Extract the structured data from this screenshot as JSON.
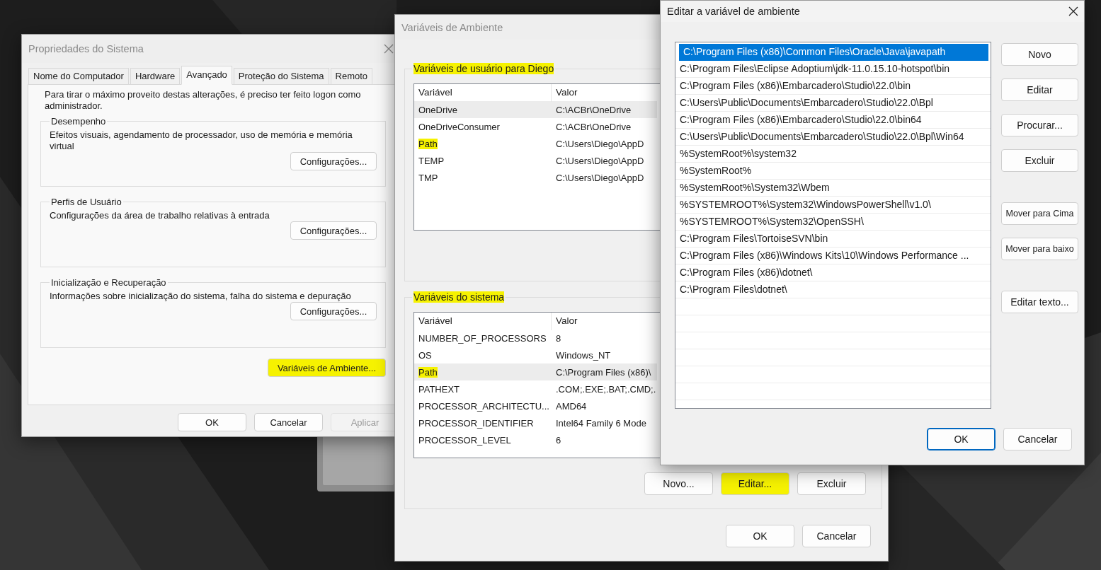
{
  "system_properties": {
    "title": "Propriedades do Sistema",
    "active": false,
    "tabs": [
      {
        "label": "Nome do Computador",
        "selected": false
      },
      {
        "label": "Hardware",
        "selected": false
      },
      {
        "label": "Avançado",
        "selected": true
      },
      {
        "label": "Proteção do Sistema",
        "selected": false
      },
      {
        "label": "Remoto",
        "selected": false
      }
    ],
    "notice": "Para tirar o máximo proveito destas alterações, é preciso ter feito logon como administrador.",
    "groups": [
      {
        "title": "Desempenho",
        "description": "Efeitos visuais, agendamento de processador, uso de memória e memória virtual",
        "button": "Configurações..."
      },
      {
        "title": "Perfis de Usuário",
        "description": "Configurações da área de trabalho relativas à entrada",
        "button": "Configurações..."
      },
      {
        "title": "Inicialização e Recuperação",
        "description": "Informações sobre inicialização do sistema, falha do sistema e depuração",
        "button": "Configurações..."
      }
    ],
    "env_button": {
      "label": "Variáveis de Ambiente...",
      "highlighted": true
    },
    "buttons": [
      {
        "label": "OK",
        "disabled": false
      },
      {
        "label": "Cancelar",
        "disabled": false
      },
      {
        "label": "Aplicar",
        "disabled": true
      }
    ]
  },
  "environment_variables": {
    "title": "Variáveis de Ambiente",
    "active": false,
    "user_group": {
      "title": "Variáveis de usuário para Diego",
      "highlighted": true,
      "columns": [
        "Variável",
        "Valor"
      ],
      "rows": [
        {
          "name": "OneDrive",
          "value": "C:\\ACBr\\OneDrive",
          "selected": true,
          "highlighted": false
        },
        {
          "name": "OneDriveConsumer",
          "value": "C:\\ACBr\\OneDrive",
          "selected": false,
          "highlighted": false
        },
        {
          "name": "Path",
          "value": "C:\\Users\\Diego\\AppD",
          "selected": false,
          "highlighted": true
        },
        {
          "name": "TEMP",
          "value": "C:\\Users\\Diego\\AppD",
          "selected": false,
          "highlighted": false
        },
        {
          "name": "TMP",
          "value": "C:\\Users\\Diego\\AppD",
          "selected": false,
          "highlighted": false
        }
      ]
    },
    "system_group": {
      "title": "Variáveis do sistema",
      "highlighted": true,
      "columns": [
        "Variável",
        "Valor"
      ],
      "rows": [
        {
          "name": "NUMBER_OF_PROCESSORS",
          "value": "8",
          "selected": false,
          "highlighted": false
        },
        {
          "name": "OS",
          "value": "Windows_NT",
          "selected": false,
          "highlighted": false
        },
        {
          "name": "Path",
          "value": "C:\\Program Files (x86)\\",
          "selected": true,
          "highlighted": true
        },
        {
          "name": "PATHEXT",
          "value": ".COM;.EXE;.BAT;.CMD;.",
          "selected": false,
          "highlighted": false
        },
        {
          "name": "PROCESSOR_ARCHITECTU...",
          "value": "AMD64",
          "selected": false,
          "highlighted": false
        },
        {
          "name": "PROCESSOR_IDENTIFIER",
          "value": "Intel64 Family 6 Mode",
          "selected": false,
          "highlighted": false
        },
        {
          "name": "PROCESSOR_LEVEL",
          "value": "6",
          "selected": false,
          "highlighted": false
        }
      ],
      "buttons": [
        {
          "label": "Novo...",
          "highlighted": false
        },
        {
          "label": "Editar...",
          "highlighted": true
        },
        {
          "label": "Excluir",
          "highlighted": false
        }
      ]
    },
    "buttons": [
      {
        "label": "OK"
      },
      {
        "label": "Cancelar"
      }
    ]
  },
  "edit_variable": {
    "title": "Editar a variável de ambiente",
    "active": true,
    "entries": [
      {
        "text": "C:\\Program Files (x86)\\Common Files\\Oracle\\Java\\javapath",
        "selected": true
      },
      {
        "text": "C:\\Program Files\\Eclipse Adoptium\\jdk-11.0.15.10-hotspot\\bin",
        "selected": false
      },
      {
        "text": "C:\\Program Files (x86)\\Embarcadero\\Studio\\22.0\\bin",
        "selected": false
      },
      {
        "text": "C:\\Users\\Public\\Documents\\Embarcadero\\Studio\\22.0\\Bpl",
        "selected": false
      },
      {
        "text": "C:\\Program Files (x86)\\Embarcadero\\Studio\\22.0\\bin64",
        "selected": false
      },
      {
        "text": "C:\\Users\\Public\\Documents\\Embarcadero\\Studio\\22.0\\Bpl\\Win64",
        "selected": false
      },
      {
        "text": "%SystemRoot%\\system32",
        "selected": false
      },
      {
        "text": "%SystemRoot%",
        "selected": false
      },
      {
        "text": "%SystemRoot%\\System32\\Wbem",
        "selected": false
      },
      {
        "text": "%SYSTEMROOT%\\System32\\WindowsPowerShell\\v1.0\\",
        "selected": false
      },
      {
        "text": "%SYSTEMROOT%\\System32\\OpenSSH\\",
        "selected": false
      },
      {
        "text": "C:\\Program Files\\TortoiseSVN\\bin",
        "selected": false
      },
      {
        "text": "C:\\Program Files (x86)\\Windows Kits\\10\\Windows Performance ...",
        "selected": false
      },
      {
        "text": "C:\\Program Files (x86)\\dotnet\\",
        "selected": false
      },
      {
        "text": "C:\\Program Files\\dotnet\\",
        "selected": false
      }
    ],
    "side_buttons": [
      {
        "label": "Novo",
        "kind": "action"
      },
      {
        "label": "Editar",
        "kind": "action"
      },
      {
        "label": "Procurar...",
        "kind": "action"
      },
      {
        "label": "Excluir",
        "kind": "action"
      },
      {
        "label": "Mover para Cima",
        "kind": "move"
      },
      {
        "label": "Mover para baixo",
        "kind": "move"
      },
      {
        "label": "Editar texto...",
        "kind": "text"
      }
    ],
    "buttons": [
      {
        "label": "OK",
        "default": true
      },
      {
        "label": "Cancelar",
        "default": false
      }
    ]
  }
}
